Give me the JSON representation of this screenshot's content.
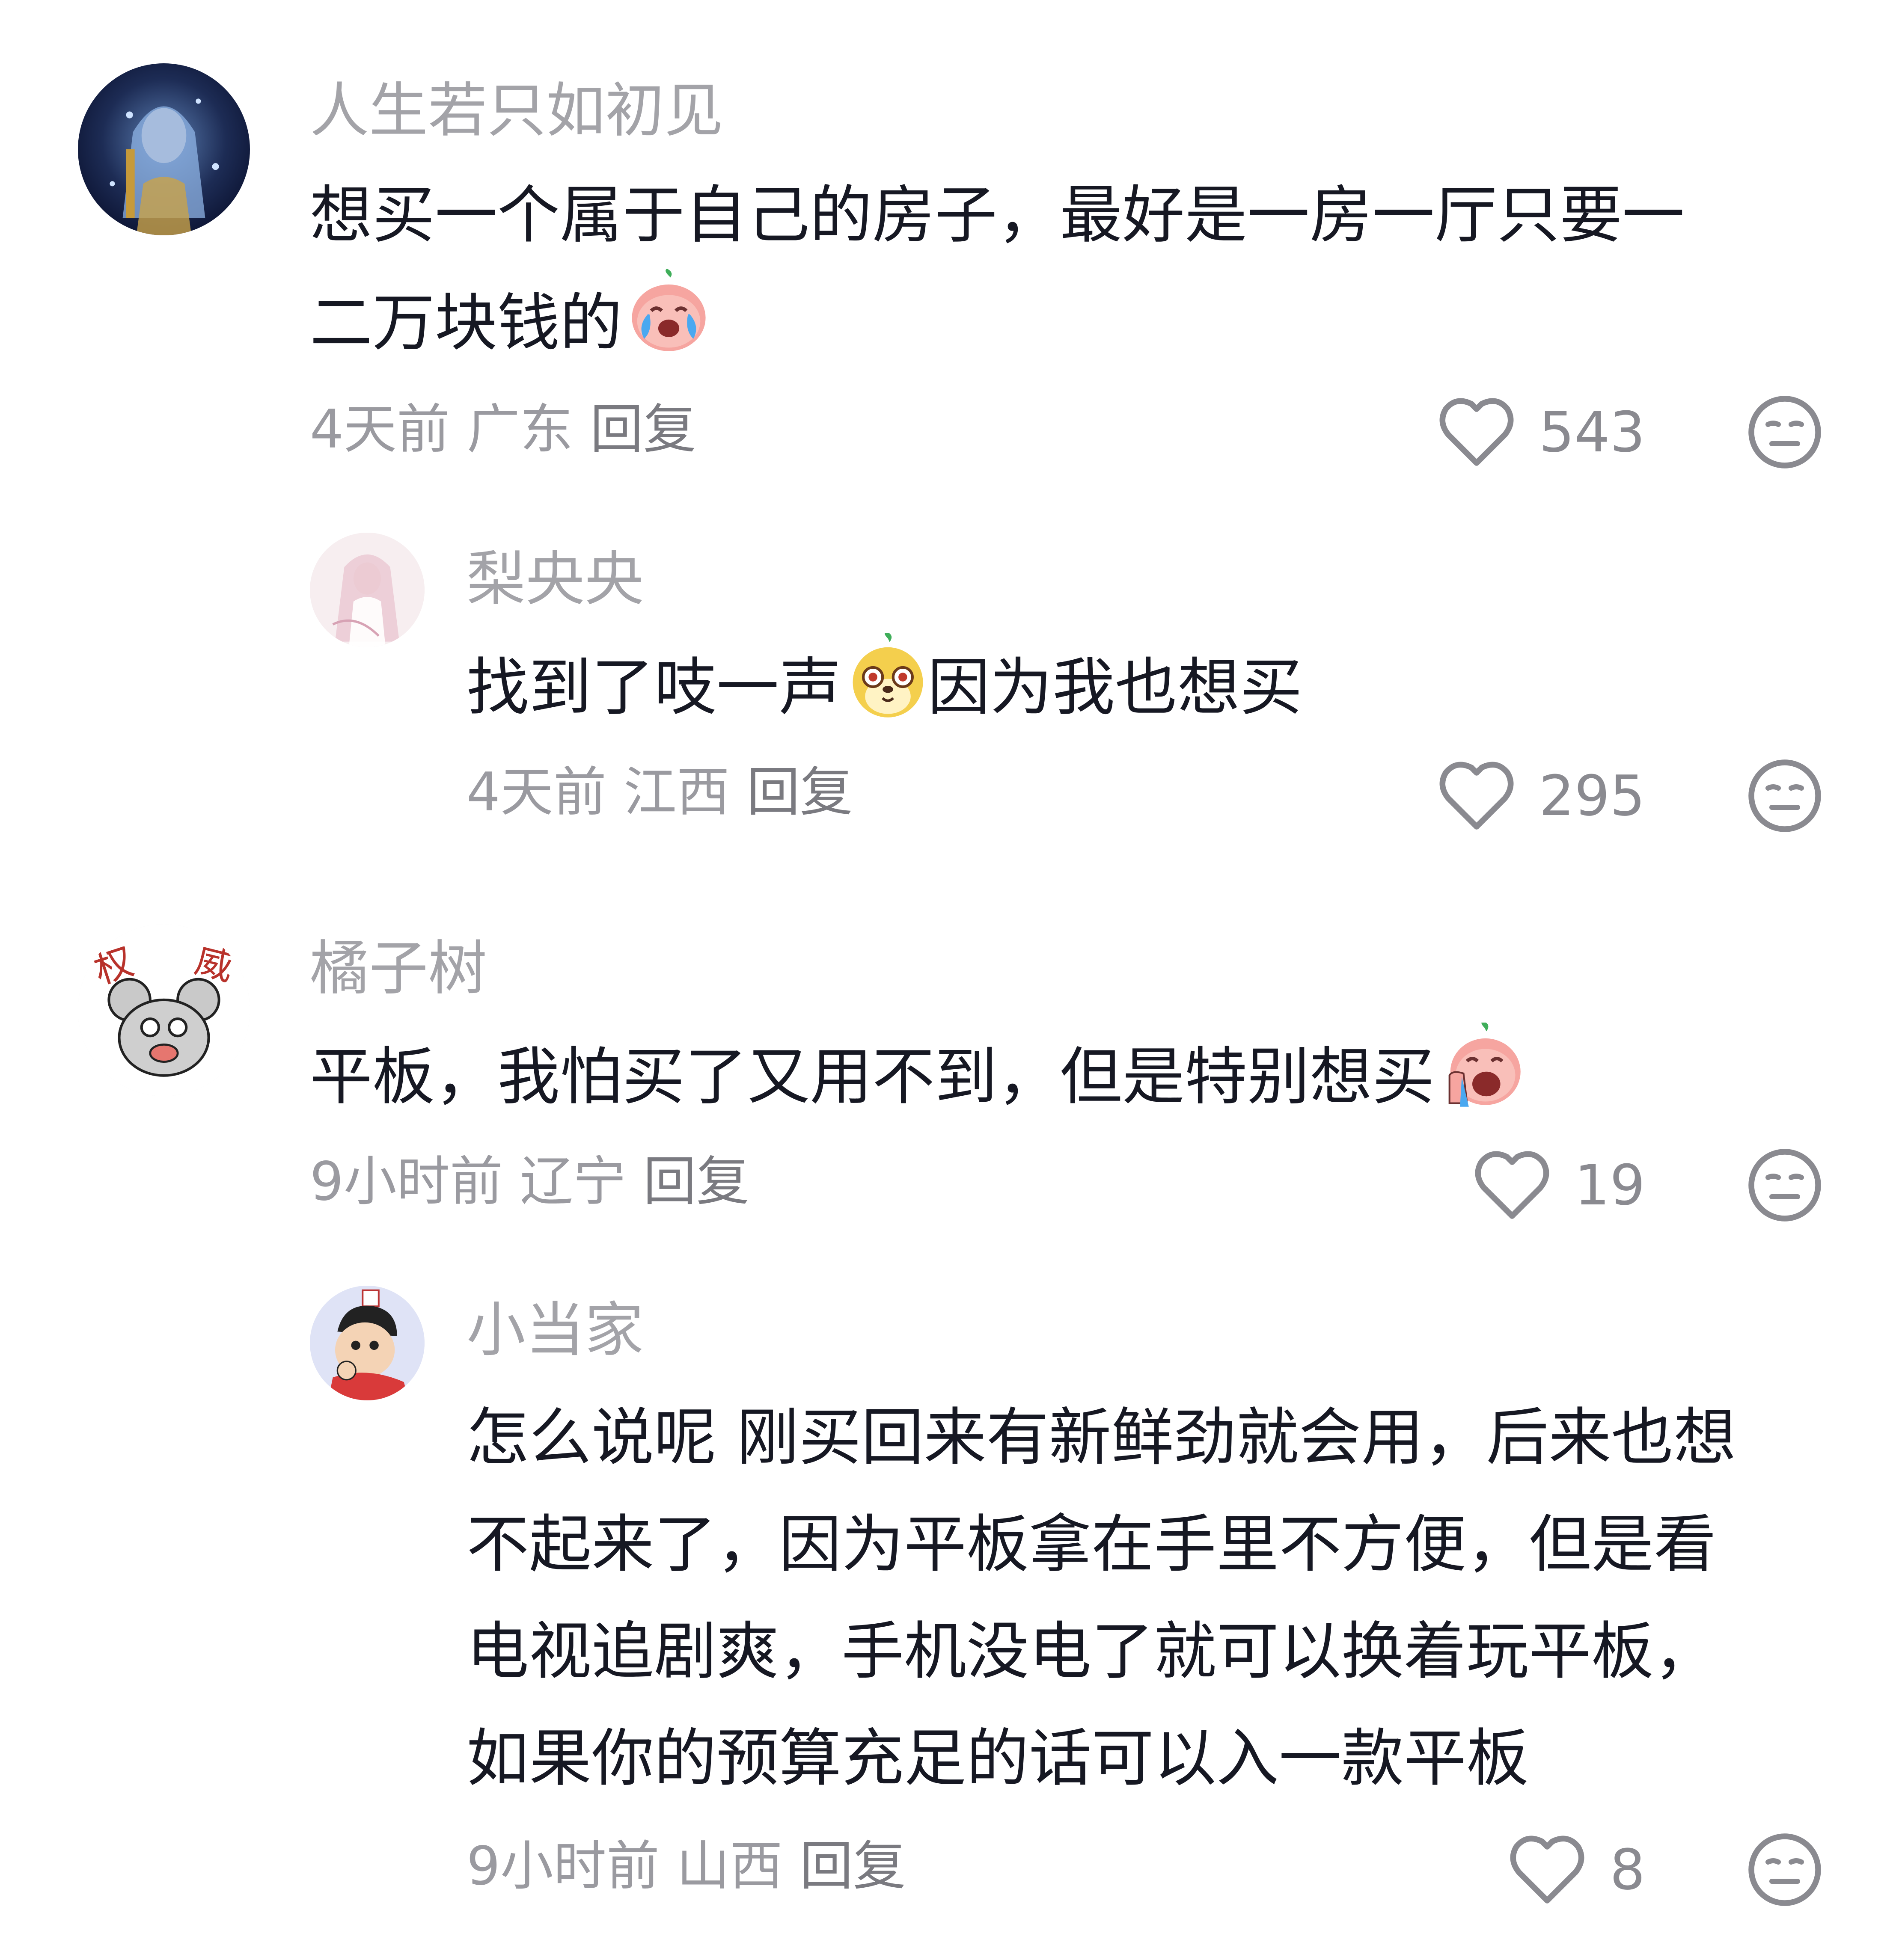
{
  "comments": [
    {
      "username": "人生若只如初见",
      "lines": [
        "想买一个属于自己的房子，最好是一房一厅只要一",
        "二万块钱的"
      ],
      "emoji": "crying-peach-emoji",
      "time": "4天前",
      "location": "广东",
      "reply_label": "回复",
      "likes": "543"
    },
    {
      "username": "梨央央",
      "lines_before_emoji": "找到了吱一声",
      "emoji": "meerkat-emoji",
      "lines_after_emoji": "因为我也想买",
      "time": "4天前",
      "location": "江西",
      "reply_label": "回复",
      "likes": "295"
    },
    {
      "username": "橘子树",
      "lines": [
        "平板，我怕买了又用不到，但是特别想买"
      ],
      "emoji": "wailing-peach-emoji",
      "avatar_text": "权威",
      "time": "9小时前",
      "location": "辽宁",
      "reply_label": "回复",
      "likes": "19"
    },
    {
      "username": "小当家",
      "lines": [
        "怎么说呢 刚买回来有新鲜劲就会用，后来也想",
        "不起来了，因为平板拿在手里不方便，但是看",
        "电视追剧爽，手机没电了就可以换着玩平板，",
        "如果你的预算充足的话可以入一款平板"
      ],
      "time": "9小时前",
      "location": "山西",
      "reply_label": "回复",
      "likes": "8"
    }
  ],
  "icons": {
    "like": "heart-outline-icon",
    "dislike": "meh-face-icon"
  },
  "colors": {
    "text": "#161823",
    "username": "#a3a3a8",
    "meta": "#9a9aa0"
  }
}
